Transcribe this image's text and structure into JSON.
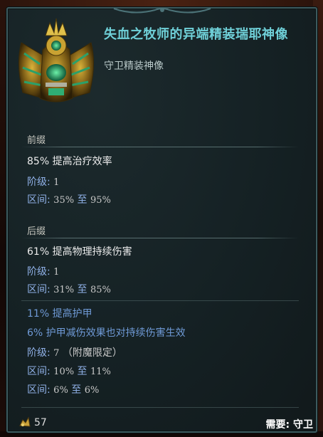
{
  "item": {
    "title": "失血之牧师的异端精装瑞耶神像",
    "subtitle": "守卫精装神像"
  },
  "prefix": {
    "header": "前缀",
    "mods": [
      {
        "text": "85% 提高治疗效率",
        "tier_label": "阶级",
        "tier": "1",
        "range_label": "区间",
        "range_min": "35%",
        "range_to": "至",
        "range_max": "95%"
      }
    ]
  },
  "suffix": {
    "header": "后缀",
    "mods": [
      {
        "text": "61% 提高物理持续伤害",
        "tier_label": "阶级",
        "tier": "1",
        "range_label": "区间",
        "range_min": "31%",
        "range_to": "至",
        "range_max": "85%"
      }
    ]
  },
  "implicit": {
    "line1": "11% 提高护甲",
    "line2": "6% 护甲减伤效果也对持续伤害生效",
    "tier_label": "阶级",
    "tier": "7",
    "tier_note": "（附魔限定）",
    "ranges": [
      {
        "label": "区间",
        "min": "10%",
        "to": "至",
        "max": "11%"
      },
      {
        "label": "区间",
        "min": "6%",
        "to": "至",
        "max": "6%"
      }
    ]
  },
  "footer": {
    "count": "57",
    "requirement": "需要: 守卫"
  },
  "colors": {
    "title": "#6fd0d8",
    "mod_blue": "#6f9ad6",
    "panel_border": "#3c5a5e"
  }
}
